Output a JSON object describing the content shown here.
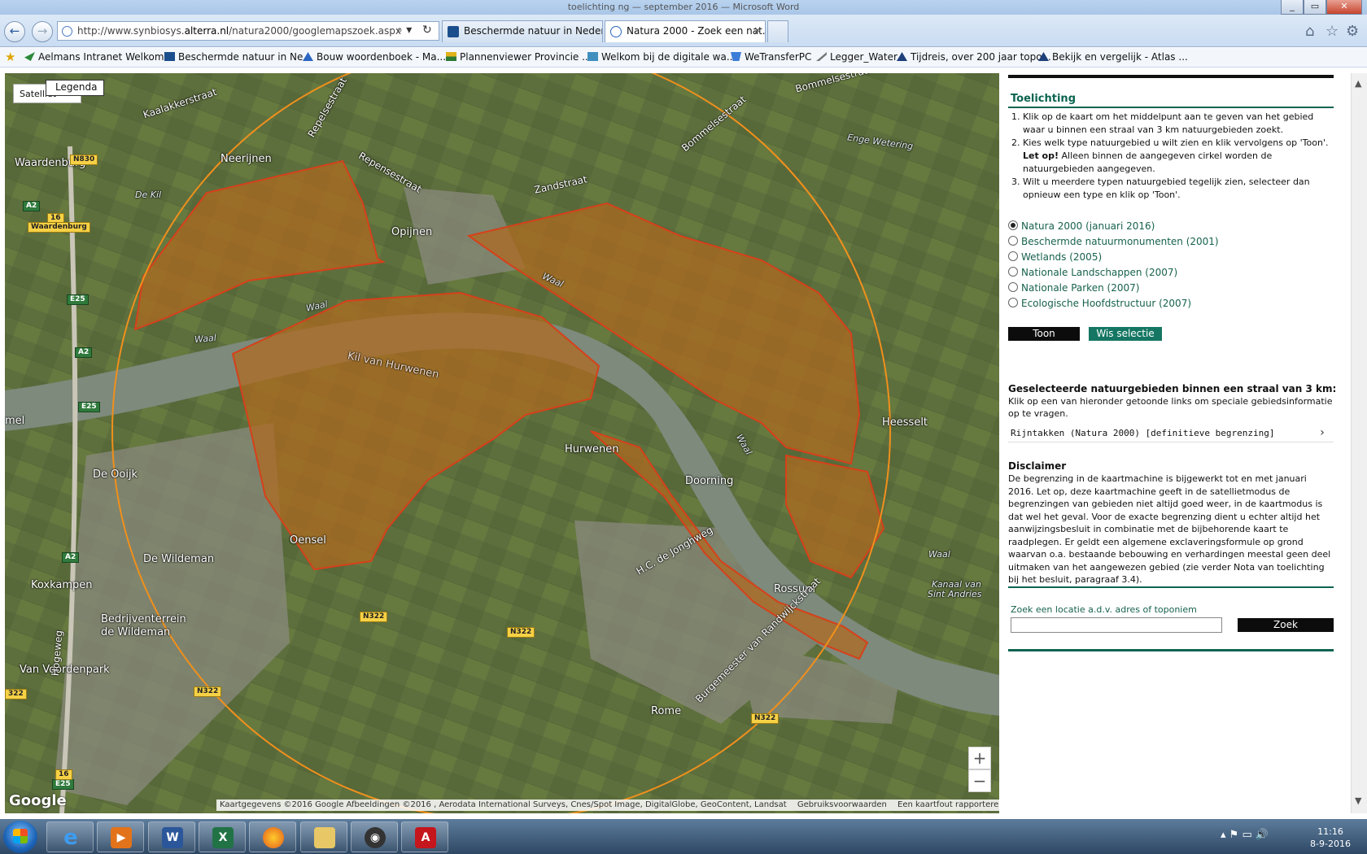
{
  "window": {
    "title": "toelichting ng — september 2016 — Microsoft Word"
  },
  "browser": {
    "url_prefix": "http://www.synbiosys.",
    "url_domain": "alterra.nl",
    "url_path": "/natura2000/googlemapszoek.aspx",
    "tabs": [
      {
        "label": "Beschermde natuur in Nederla..."
      },
      {
        "label": "Natura 2000 - Zoek een nat..."
      }
    ],
    "tab_close": "×",
    "favorites": [
      {
        "label": "Aelmans Intranet  Welkom",
        "icon_color": "#2c8a3a"
      },
      {
        "label": "Beschermde natuur in Ne...",
        "icon_color": "#1b4e8c"
      },
      {
        "label": "Bouw woordenboek - Ma...",
        "icon_color": "#2b66c1"
      },
      {
        "label": "Plannenviewer Provincie ...",
        "icon_color": "#e2b21b"
      },
      {
        "label": "Welkom bij de digitale wa...",
        "icon_color": "#3f8fbf"
      },
      {
        "label": "WeTransferPC",
        "icon_color": "#3b7dd8"
      },
      {
        "label": "Legger_Water",
        "icon_color": "#777777"
      },
      {
        "label": "Tijdreis, over 200 jaar topo...",
        "icon_color": "#1d3f7a"
      },
      {
        "label": "Bekijk en vergelijk - Atlas ...",
        "icon_color": "#1d3f7a"
      }
    ]
  },
  "map": {
    "satellite_label": "Satelliet",
    "legend_label": "Legenda",
    "zoom_in": "+",
    "zoom_out": "−",
    "google_label": "Google",
    "footer": {
      "attribution": "Kaartgegevens ©2016 Google Afbeeldingen ©2016 , Aerodata International Surveys, Cnes/Spot Image, DigitalGlobe, GeoContent, Landsat",
      "terms": "Gebruiksvoorwaarden",
      "report": "Een kaartfout rapporteren"
    },
    "labels": {
      "waardenburg": "Waardenburg",
      "neerijnen": "Neerijnen",
      "opijnen": "Opijnen",
      "kaalakkerstraat": "Kaalakkerstraat",
      "repelsestraat": "Repelsestraat",
      "repensestraat": "Repensestraat",
      "zandstraat": "Zandstraat",
      "bommelsestraat": "Bommelsestraat",
      "bommelsestraat2": "Bommelsestraat",
      "enge_wetering": "Enge Wetering",
      "de_kil": "De Kil",
      "waal1": "Waal",
      "waal2": "Waal",
      "waal3": "Waal",
      "waal4": "Waal",
      "waal5": "Waal",
      "kil_hurwenen": "Kil van Hurwenen",
      "hurwenen": "Hurwenen",
      "heesselt": "Heesselt",
      "doorning": "Doorning",
      "de_ooijk": "De Ooijk",
      "de_wildeman": "De Wildeman",
      "koxkampen": "Koxkampen",
      "bedrijventerrein": "Bedrijventerrein",
      "bedrijventerrein2": "de Wildeman",
      "van_voordenpark": "Van Voordenpark",
      "oensel": "Oensel",
      "jongh": "H.C. de Jonghweg",
      "rossum": "Rossum",
      "rome": "Rome",
      "burgemeester": "Burgemeester van Randwijckstraat",
      "kanaal": "Kanaal van",
      "kanaal2": "Sint Andries",
      "hogeweg": "Hogeweg",
      "mel": "mel"
    },
    "roads": {
      "n830": "N830",
      "a2_1": "A2",
      "n16": "16",
      "waardenburg_exit": "Waardenburg",
      "e25_1": "E25",
      "a2_2": "A2",
      "e25_2": "E25",
      "a2_3": "A2",
      "n322_1": "N322",
      "n322_2": "N322",
      "n322_3": "N322",
      "n322_4": "N322",
      "n322_5": "322",
      "e25_3": "E25",
      "n16b": "16"
    }
  },
  "panel": {
    "title": "Toelichting",
    "steps": [
      "Klik op de kaart om het middelpunt aan te geven van het gebied waar u binnen een straal van 3 km natuurgebieden zoekt.",
      "Kies welk type natuurgebied u wilt zien en klik vervolgens op 'Toon'.",
      "Wilt u meerdere typen natuurgebied tegelijk zien, selecteer dan opnieuw een type en klik op 'Toon'."
    ],
    "note_bold": "Let op!",
    "note_text": " Alleen binnen de aangegeven cirkel worden de natuurgebieden aangegeven.",
    "options": [
      {
        "label": "Natura 2000 (januari 2016)",
        "selected": true
      },
      {
        "label": "Beschermde natuurmonumenten (2001)",
        "selected": false
      },
      {
        "label": "Wetlands (2005)",
        "selected": false
      },
      {
        "label": "Nationale Landschappen (2007)",
        "selected": false
      },
      {
        "label": "Nationale Parken (2007)",
        "selected": false
      },
      {
        "label": "Ecologische Hoofdstructuur (2007)",
        "selected": false
      }
    ],
    "toon_label": "Toon",
    "clear_label": "Wis selectie",
    "selected_heading": "Geselecteerde natuurgebieden binnen een straal van 3 km:",
    "selected_text": "Klik op een van hieronder getoonde links om speciale gebiedsinformatie op te vragen.",
    "result": "Rijntakken (Natura 2000) [definitieve begrenzing]",
    "result_chevron": "›",
    "disclaimer_heading": "Disclaimer",
    "disclaimer_text": "De begrenzing in de kaartmachine is bijgewerkt tot en met januari 2016. Let op, deze kaartmachine geeft in de satellietmodus de begrenzingen van gebieden niet altijd goed weer, in de kaartmodus is dat wel het geval. Voor de exacte begrenzing dient u echter altijd het aanwijzingsbesluit in combinatie met de bijbehorende kaart te raadplegen. Er geldt een algemene exclaveringsformule op grond waarvan o.a. bestaande bebouwing en verhardingen meestal geen deel uitmaken van het aangewezen gebied (zie verder Nota van toelichting bij het besluit, paragraaf 3.4).",
    "search_label": "Zoek een locatie a.d.v. adres of toponiem",
    "search_value": "",
    "search_button": "Zoek"
  },
  "taskbar": {
    "time": "11:16",
    "date": "8-9-2016"
  },
  "colors": {
    "accent_green": "#157763",
    "label_green": "#17624d",
    "natura_fill": "#b06a1e",
    "natura_stroke": "#d6401a",
    "radius_stroke": "#f0901c"
  }
}
